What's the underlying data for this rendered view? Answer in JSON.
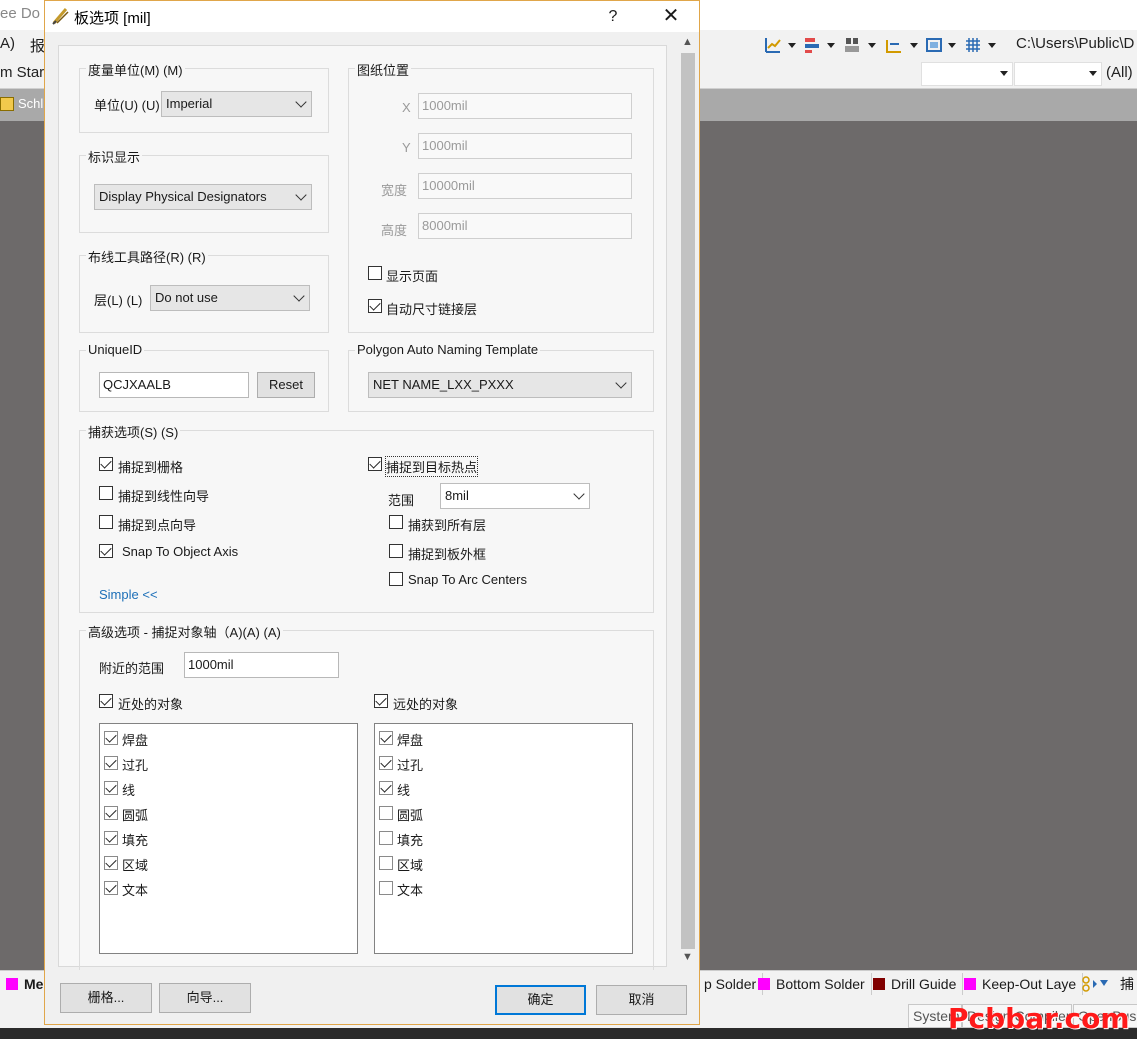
{
  "background_app": {
    "title_fragment": "ee Do",
    "menu": [
      "A)",
      "报"
    ],
    "toolbar2_left": "m Star",
    "path_text": "C:\\Users\\Public\\D",
    "filter_all": "(All)",
    "doc_tab": "Schli",
    "layer_tabs": [
      {
        "label": "Me",
        "color": "#ff00ff"
      },
      {
        "label": "p Solder",
        "color": "#ff00ff"
      },
      {
        "label": "Bottom Solder",
        "color": "#ff00ff"
      },
      {
        "label": "Drill Guide",
        "color": "#800000"
      },
      {
        "label": "Keep-Out Laye",
        "color": "#ff00ff"
      },
      {
        "label": "捕",
        "color": ""
      }
    ],
    "status_tabs": [
      "System",
      "Design Compiler",
      "OpenBus"
    ],
    "watermark": "Pcbbar.com"
  },
  "dialog": {
    "title": "板选项 [mil]",
    "help": "?",
    "close": "✕",
    "units": {
      "title": "度量单位(M) (M)",
      "unit_label": "单位(U) (U)",
      "unit_value": "Imperial"
    },
    "designator": {
      "title": "标识显示",
      "value": "Display Physical Designators"
    },
    "route_tool": {
      "title": "布线工具路径(R) (R)",
      "layer_label": "层(L) (L)",
      "layer_value": "Do not use"
    },
    "uniqueid": {
      "title": "UniqueID",
      "value": "QCJXAALB",
      "reset": "Reset"
    },
    "sheet_position": {
      "title": "图纸位置",
      "x_label": "X",
      "x_value": "1000mil",
      "y_label": "Y",
      "y_value": "1000mil",
      "width_label": "宽度",
      "width_value": "10000mil",
      "height_label": "高度",
      "height_value": "8000mil",
      "display_sheet": "显示页面",
      "display_sheet_checked": false,
      "auto_size": "自动尺寸链接层",
      "auto_size_checked": true
    },
    "polygon_naming": {
      "title": "Polygon Auto Naming Template",
      "value": "NET NAME_LXX_PXXX"
    },
    "snap": {
      "title": "捕获选项(S) (S)",
      "snap_grid": "捕捉到栅格",
      "snap_grid_checked": true,
      "snap_linear": "捕捉到线性向导",
      "snap_linear_checked": false,
      "snap_point": "捕捉到点向导",
      "snap_point_checked": false,
      "snap_axis": "Snap To Object Axis",
      "snap_axis_checked": true,
      "simple_link": "Simple <<",
      "snap_hotspot": "捕捉到目标热点",
      "snap_hotspot_checked": true,
      "range_label": "范围",
      "range_value": "8mil",
      "all_layers": "捕获到所有层",
      "all_layers_checked": false,
      "board_outline": "捕捉到板外框",
      "board_outline_checked": false,
      "arc_centers": "Snap To Arc Centers",
      "arc_centers_checked": false
    },
    "advanced": {
      "title": "高级选项 - 捕捉对象轴（A)(A) (A)",
      "near_range_label": "附近的范围",
      "near_range_value": "1000mil",
      "near_objects": "近处的对象",
      "near_objects_checked": true,
      "far_objects": "远处的对象",
      "far_objects_checked": true,
      "near_items": [
        {
          "label": "焊盘",
          "checked": true
        },
        {
          "label": "过孔",
          "checked": true
        },
        {
          "label": "线",
          "checked": true
        },
        {
          "label": "圆弧",
          "checked": true
        },
        {
          "label": "填充",
          "checked": true
        },
        {
          "label": "区域",
          "checked": true
        },
        {
          "label": "文本",
          "checked": true
        }
      ],
      "far_items": [
        {
          "label": "焊盘",
          "checked": true
        },
        {
          "label": "过孔",
          "checked": true
        },
        {
          "label": "线",
          "checked": true
        },
        {
          "label": "圆弧",
          "checked": false
        },
        {
          "label": "填充",
          "checked": false
        },
        {
          "label": "区域",
          "checked": false
        },
        {
          "label": "文本",
          "checked": false
        }
      ]
    },
    "buttons": {
      "grid": "栅格...",
      "guide": "向导...",
      "ok": "确定",
      "cancel": "取消"
    }
  }
}
